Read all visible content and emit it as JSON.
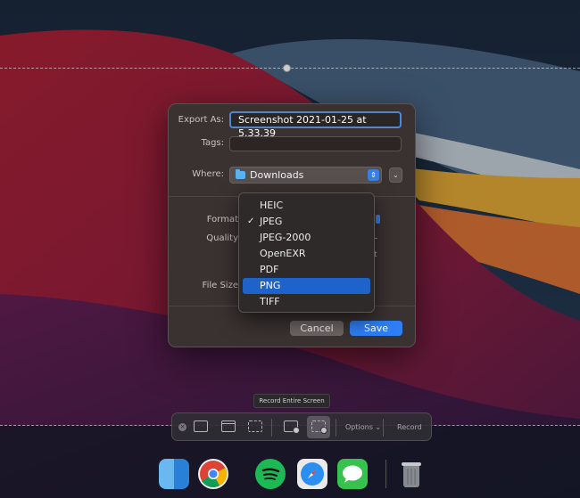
{
  "dialog": {
    "export_as_label": "Export As:",
    "export_as_value": "Screenshot 2021-01-25 at 5.33.39",
    "tags_label": "Tags:",
    "tags_value": "",
    "where_label": "Where:",
    "where_value": "Downloads",
    "format_label": "Format",
    "quality_label": "Quality",
    "file_size_label": "File Size",
    "cancel_label": "Cancel",
    "save_label": "Save"
  },
  "format_menu": {
    "items": [
      {
        "label": "HEIC",
        "checked": false,
        "highlighted": false
      },
      {
        "label": "JPEG",
        "checked": true,
        "highlighted": false
      },
      {
        "label": "JPEG-2000",
        "checked": false,
        "highlighted": false
      },
      {
        "label": "OpenEXR",
        "checked": false,
        "highlighted": false
      },
      {
        "label": "PDF",
        "checked": false,
        "highlighted": false
      },
      {
        "label": "PNG",
        "checked": false,
        "highlighted": true
      },
      {
        "label": "TIFF",
        "checked": false,
        "highlighted": false
      }
    ],
    "checkmark": "✓"
  },
  "toolbar": {
    "tooltip": "Record Entire Screen",
    "options_label": "Options ⌄",
    "record_label": "Record"
  },
  "dock": {
    "apps": [
      "finder",
      "chrome",
      "spotify",
      "safari",
      "messages",
      "trash"
    ]
  },
  "colors": {
    "accent": "#2f7ff2",
    "highlight": "#1e63c9"
  }
}
